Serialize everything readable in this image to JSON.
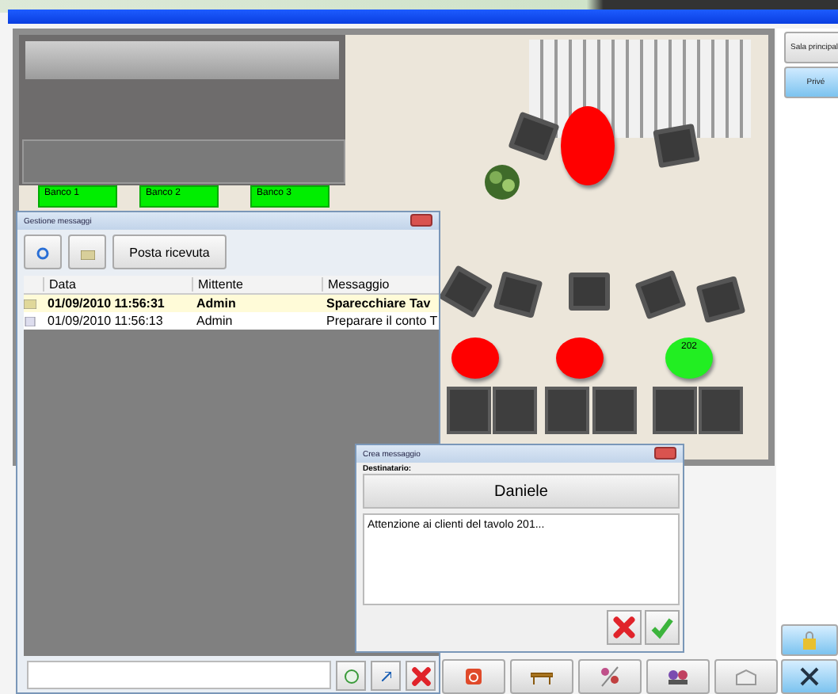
{
  "map": {
    "counters": [
      {
        "label": "Banco 1"
      },
      {
        "label": "Banco 2"
      },
      {
        "label": "Banco 3"
      }
    ],
    "tables": [
      {
        "color": "#ff0000"
      },
      {
        "color": "#ff0000"
      },
      {
        "color": "#ff0000"
      },
      {
        "label": "202",
        "color": "#22ee22"
      }
    ]
  },
  "rooms": [
    {
      "label": "Sala principal",
      "selected": false
    },
    {
      "label": "Privé",
      "selected": true
    }
  ],
  "messages_window": {
    "title": "Gestione messaggi",
    "inbox_button": "Posta ricevuta",
    "columns": [
      "Data",
      "Mittente",
      "Messaggio"
    ],
    "rows": [
      {
        "date": "01/09/2010 11:56:31",
        "sender": "Admin",
        "message": "Sparecchiare Tav",
        "unread": true
      },
      {
        "date": "01/09/2010 11:56:13",
        "sender": "Admin",
        "message": "Preparare il conto T",
        "unread": false
      }
    ]
  },
  "compose_dialog": {
    "title": "Crea messaggio",
    "recipient_label": "Destinatario:",
    "recipient": "Daniele",
    "body": "Attenzione ai clienti del tavolo 201..."
  }
}
